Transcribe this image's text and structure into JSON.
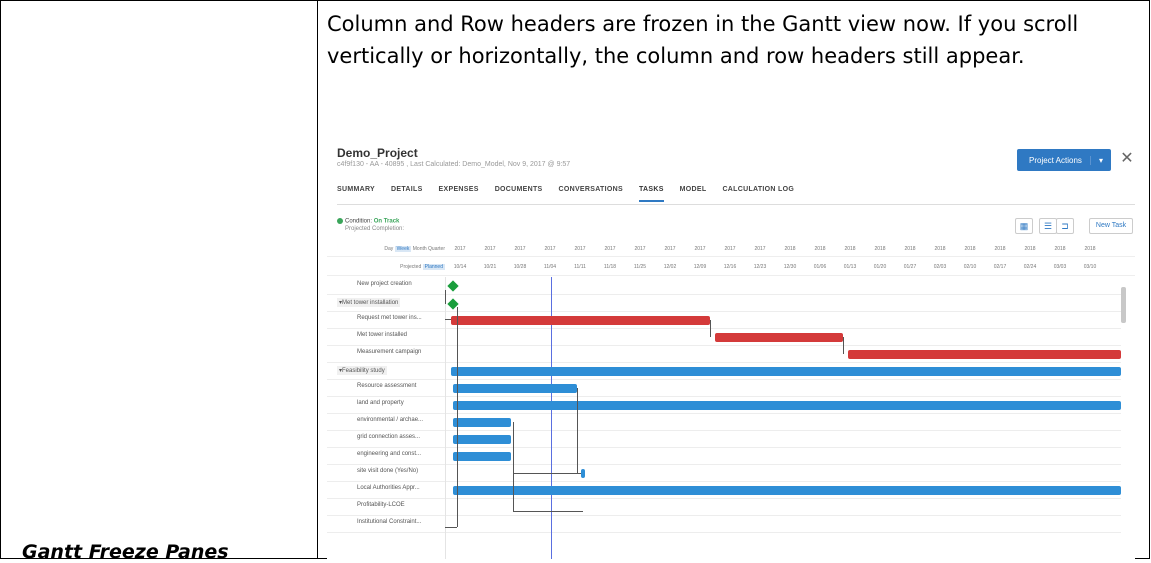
{
  "feature_label": "Gantt Freeze Panes",
  "description": "Column and Row headers are frozen in the Gantt view now.  If you scroll vertically or horizontally, the column and row headers still appear.",
  "screenshot": {
    "title": "Demo_Project",
    "subtitle": "c4f9f130 - AA - 40895 , Last Calculated: Demo_Model, Nov 9, 2017 @ 9:57",
    "project_actions_label": "Project Actions",
    "caret": "▾",
    "close": "✕",
    "tabs": [
      "SUMMARY",
      "DETAILS",
      "EXPENSES",
      "DOCUMENTS",
      "CONVERSATIONS",
      "TASKS",
      "MODEL",
      "CALCULATION LOG"
    ],
    "active_tab": "TASKS",
    "status_prefix": "Condition:",
    "status_value": "On Track",
    "projected_completion": "Projected Completion:",
    "new_task_label": "New Task",
    "header_controls": {
      "zoom": [
        "Day",
        "Week",
        "Month",
        "Quarter"
      ],
      "zoom_selected": "Week",
      "mode": [
        "Projected",
        "Planned"
      ],
      "mode_selected": "Planned"
    },
    "years": [
      "2017",
      "2017",
      "2017",
      "2017",
      "2017",
      "2017",
      "2017",
      "2017",
      "2017",
      "2017",
      "2017",
      "2018",
      "2018",
      "2018",
      "2018",
      "2018",
      "2018",
      "2018",
      "2018",
      "2018",
      "2018",
      "2018"
    ],
    "dates": [
      "10/14",
      "10/21",
      "10/28",
      "11/04",
      "11/11",
      "11/18",
      "11/25",
      "12/02",
      "12/09",
      "12/16",
      "12/23",
      "12/30",
      "01/06",
      "01/13",
      "01/20",
      "01/27",
      "02/03",
      "02/10",
      "02/17",
      "02/24",
      "03/03",
      "03/10"
    ],
    "rows": [
      {
        "label": "New project creation",
        "kind": "first"
      },
      {
        "label": "Met tower installation",
        "kind": "group"
      },
      {
        "label": "Request met tower ins...",
        "kind": "task"
      },
      {
        "label": "Met tower installed",
        "kind": "task"
      },
      {
        "label": "Measurement campaign",
        "kind": "task"
      },
      {
        "label": "Feasibility study",
        "kind": "group"
      },
      {
        "label": "Resource assessment",
        "kind": "task"
      },
      {
        "label": "land and property",
        "kind": "task"
      },
      {
        "label": "environmental / archae...",
        "kind": "task"
      },
      {
        "label": "grid connection asses...",
        "kind": "task"
      },
      {
        "label": "engineering and const...",
        "kind": "task"
      },
      {
        "label": "site visit done (Yes/No)",
        "kind": "task"
      },
      {
        "label": "Local Authorities Appr...",
        "kind": "task"
      },
      {
        "label": "Profitability-LCOE",
        "kind": "task"
      },
      {
        "label": "Institutional Constraint...",
        "kind": "task"
      }
    ],
    "colors": {
      "accent": "#2f79c3",
      "red_bar": "#d43a3a",
      "blue_bar": "#2e8ed6",
      "milestone": "#1a9e3c",
      "today": "#5a6fe0"
    }
  }
}
